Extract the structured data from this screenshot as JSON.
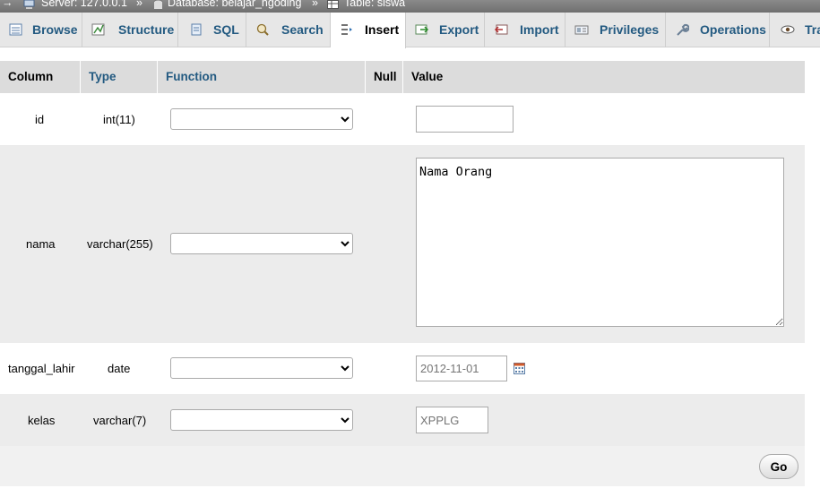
{
  "breadcrumb": {
    "arrow": "→",
    "server": "Server: 127.0.0.1",
    "separator": "»",
    "database": "Database: belajar_ngoding",
    "table": "Table: siswa"
  },
  "tabs": [
    {
      "label": "Browse",
      "icon": "browse-icon"
    },
    {
      "label": "Structure",
      "icon": "structure-icon"
    },
    {
      "label": "SQL",
      "icon": "sql-icon"
    },
    {
      "label": "Search",
      "icon": "search-icon"
    },
    {
      "label": "Insert",
      "icon": "insert-icon",
      "active": true
    },
    {
      "label": "Export",
      "icon": "export-icon"
    },
    {
      "label": "Import",
      "icon": "import-icon"
    },
    {
      "label": "Privileges",
      "icon": "privileges-icon"
    },
    {
      "label": "Operations",
      "icon": "operations-icon"
    },
    {
      "label": "Tra",
      "icon": "tracking-icon"
    }
  ],
  "table": {
    "headers": {
      "column": "Column",
      "type": "Type",
      "function": "Function",
      "null": "Null",
      "value": "Value"
    },
    "rows": [
      {
        "column": "id",
        "type": "int(11)",
        "function": "",
        "value": "",
        "placeholder": ""
      },
      {
        "column": "nama",
        "type": "varchar(255)",
        "function": "",
        "value": "Nama Orang"
      },
      {
        "column": "tanggal_lahir",
        "type": "date",
        "function": "",
        "value": "",
        "placeholder": "2012-11-01"
      },
      {
        "column": "kelas",
        "type": "varchar(7)",
        "function": "",
        "value": "",
        "placeholder": "XPPLG"
      }
    ]
  },
  "go_label": "Go",
  "colors": {
    "tab_bg": "#e7e7e7",
    "link": "#235a81",
    "header_bg": "#dcdcdc",
    "row_alt": "#ececec"
  }
}
